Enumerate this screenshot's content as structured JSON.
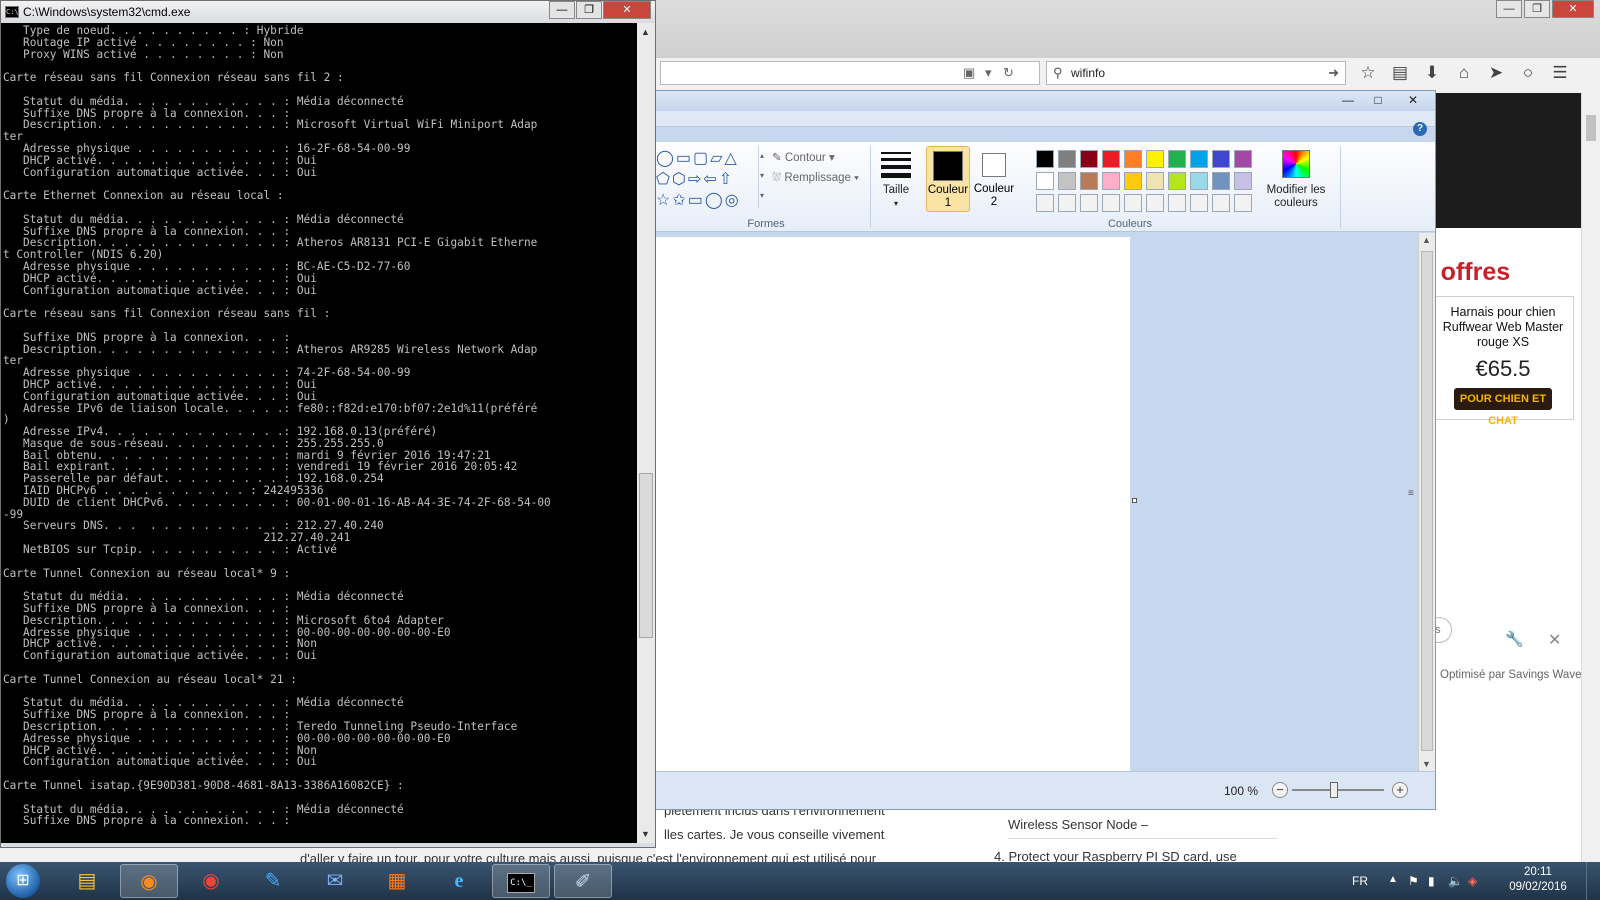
{
  "browser": {
    "search_value": "wifinfo",
    "offres_heading": "r offres",
    "product": {
      "name_line1": "Harnais pour chien",
      "name_line2": "Ruffwear Web Master",
      "name_line3": "rouge XS",
      "price": "€65.5",
      "logo_text": "POUR CHIEN ET CHAT"
    },
    "partial_es": "es",
    "savings_text": "Optimisé par Savings Wave",
    "article_line1": "plètement inclus dans l'environnement",
    "article_line2": "lles cartes. Je vous conseille vivement",
    "article_line3": "d'aller y faire un tour, pour votre culture mais aussi, puisque c'est l'environnement qui est utilisé pour",
    "side_line1": "Wireless Sensor Node –",
    "side_line2": "4.  Protect your Raspberry PI SD card, use"
  },
  "paint": {
    "shape_outline": "Contour",
    "shape_fill": "Remplissage",
    "group_shapes": "Formes",
    "size_label": "Taille",
    "color1_label": "Couleur 1",
    "color2_label": "Couleur 2",
    "group_colors": "Couleurs",
    "edit_colors_label": "Modifier les couleurs",
    "zoom": "100 %",
    "zoom_level_fraction": 0.46,
    "color1": "#000000",
    "color2": "#ffffff",
    "palette": [
      "#000000",
      "#7f7f7f",
      "#880015",
      "#ed1c24",
      "#ff7f27",
      "#fff200",
      "#22b14c",
      "#00a2e8",
      "#3f48cc",
      "#a349a4",
      "#ffffff",
      "#c3c3c3",
      "#b97a57",
      "#ffaec9",
      "#ffc90e",
      "#efe4b0",
      "#b5e61d",
      "#99d9ea",
      "#7092be",
      "#c8bfe7",
      "#f2f2f2",
      "#f2f2f2",
      "#f2f2f2",
      "#f2f2f2",
      "#f2f2f2",
      "#f2f2f2",
      "#f2f2f2",
      "#f2f2f2",
      "#f2f2f2",
      "#f2f2f2"
    ]
  },
  "cmd": {
    "title": "C:\\Windows\\system32\\cmd.exe",
    "output": "   Type de noeud. . . . . . . . . . : Hybride\n   Routage IP activé . . . . . . . . : Non\n   Proxy WINS activé . . . . . . . . : Non\n\nCarte réseau sans fil Connexion réseau sans fil 2 :\n\n   Statut du média. . . . . . . . . . . . : Média déconnecté\n   Suffixe DNS propre à la connexion. . . :\n   Description. . . . . . . . . . . . . . : Microsoft Virtual WiFi Miniport Adap\nter\n   Adresse physique . . . . . . . . . . . : 16-2F-68-54-00-99\n   DHCP activé. . . . . . . . . . . . . . : Oui\n   Configuration automatique activée. . . : Oui\n\nCarte Ethernet Connexion au réseau local :\n\n   Statut du média. . . . . . . . . . . . : Média déconnecté\n   Suffixe DNS propre à la connexion. . . :\n   Description. . . . . . . . . . . . . . : Atheros AR8131 PCI-E Gigabit Etherne\nt Controller (NDIS 6.20)\n   Adresse physique . . . . . . . . . . . : BC-AE-C5-D2-77-60\n   DHCP activé. . . . . . . . . . . . . . : Oui\n   Configuration automatique activée. . . : Oui\n\nCarte réseau sans fil Connexion réseau sans fil :\n\n   Suffixe DNS propre à la connexion. . . :\n   Description. . . . . . . . . . . . . . : Atheros AR9285 Wireless Network Adap\nter\n   Adresse physique . . . . . . . . . . . : 74-2F-68-54-00-99\n   DHCP activé. . . . . . . . . . . . . . : Oui\n   Configuration automatique activée. . . : Oui\n   Adresse IPv6 de liaison locale. . . . .: fe80::f82d:e170:bf07:2e1d%11(préféré\n)\n   Adresse IPv4. . . . . . . . . . . . . .: 192.168.0.13(préféré)\n   Masque de sous-réseau. . . . . . . . . : 255.255.255.0\n   Bail obtenu. . . . . . . . . . . . . . : mardi 9 février 2016 19:47:21\n   Bail expirant. . . . . . . . . . . . . : vendredi 19 février 2016 20:05:42\n   Passerelle par défaut. . . . . . . . . : 192.168.0.254\n   IAID DHCPv6 . . . . . . . . . . . : 242495336\n   DUID de client DHCPv6. . . . . . . . . : 00-01-00-01-16-AB-A4-3E-74-2F-68-54-00\n-99\n   Serveurs DNS. . .  . . . . . . . . . . : 212.27.40.240\n                                       212.27.40.241\n   NetBIOS sur Tcpip. . . . . . . . . . . : Activé\n\nCarte Tunnel Connexion au réseau local* 9 :\n\n   Statut du média. . . . . . . . . . . . : Média déconnecté\n   Suffixe DNS propre à la connexion. . . :\n   Description. . . . . . . . . . . . . . : Microsoft 6to4 Adapter\n   Adresse physique . . . . . . . . . . . : 00-00-00-00-00-00-00-E0\n   DHCP activé. . . . . . . . . . . . . . : Non\n   Configuration automatique activée. . . : Oui\n\nCarte Tunnel Connexion au réseau local* 21 :\n\n   Statut du média. . . . . . . . . . . . : Média déconnecté\n   Suffixe DNS propre à la connexion. . . :\n   Description. . . . . . . . . . . . . . : Teredo Tunneling Pseudo-Interface\n   Adresse physique . . . . . . . . . . . : 00-00-00-00-00-00-00-E0\n   DHCP activé. . . . . . . . . . . . . . : Non\n   Configuration automatique activée. . . : Oui\n\nCarte Tunnel isatap.{9E90D381-90D8-4681-8A13-3386A16082CE} :\n\n   Statut du média. . . . . . . . . . . . : Média déconnecté\n   Suffixe DNS propre à la connexion. . . :"
  },
  "taskbar": {
    "language": "FR",
    "time": "20:11",
    "date": "09/02/2016"
  }
}
